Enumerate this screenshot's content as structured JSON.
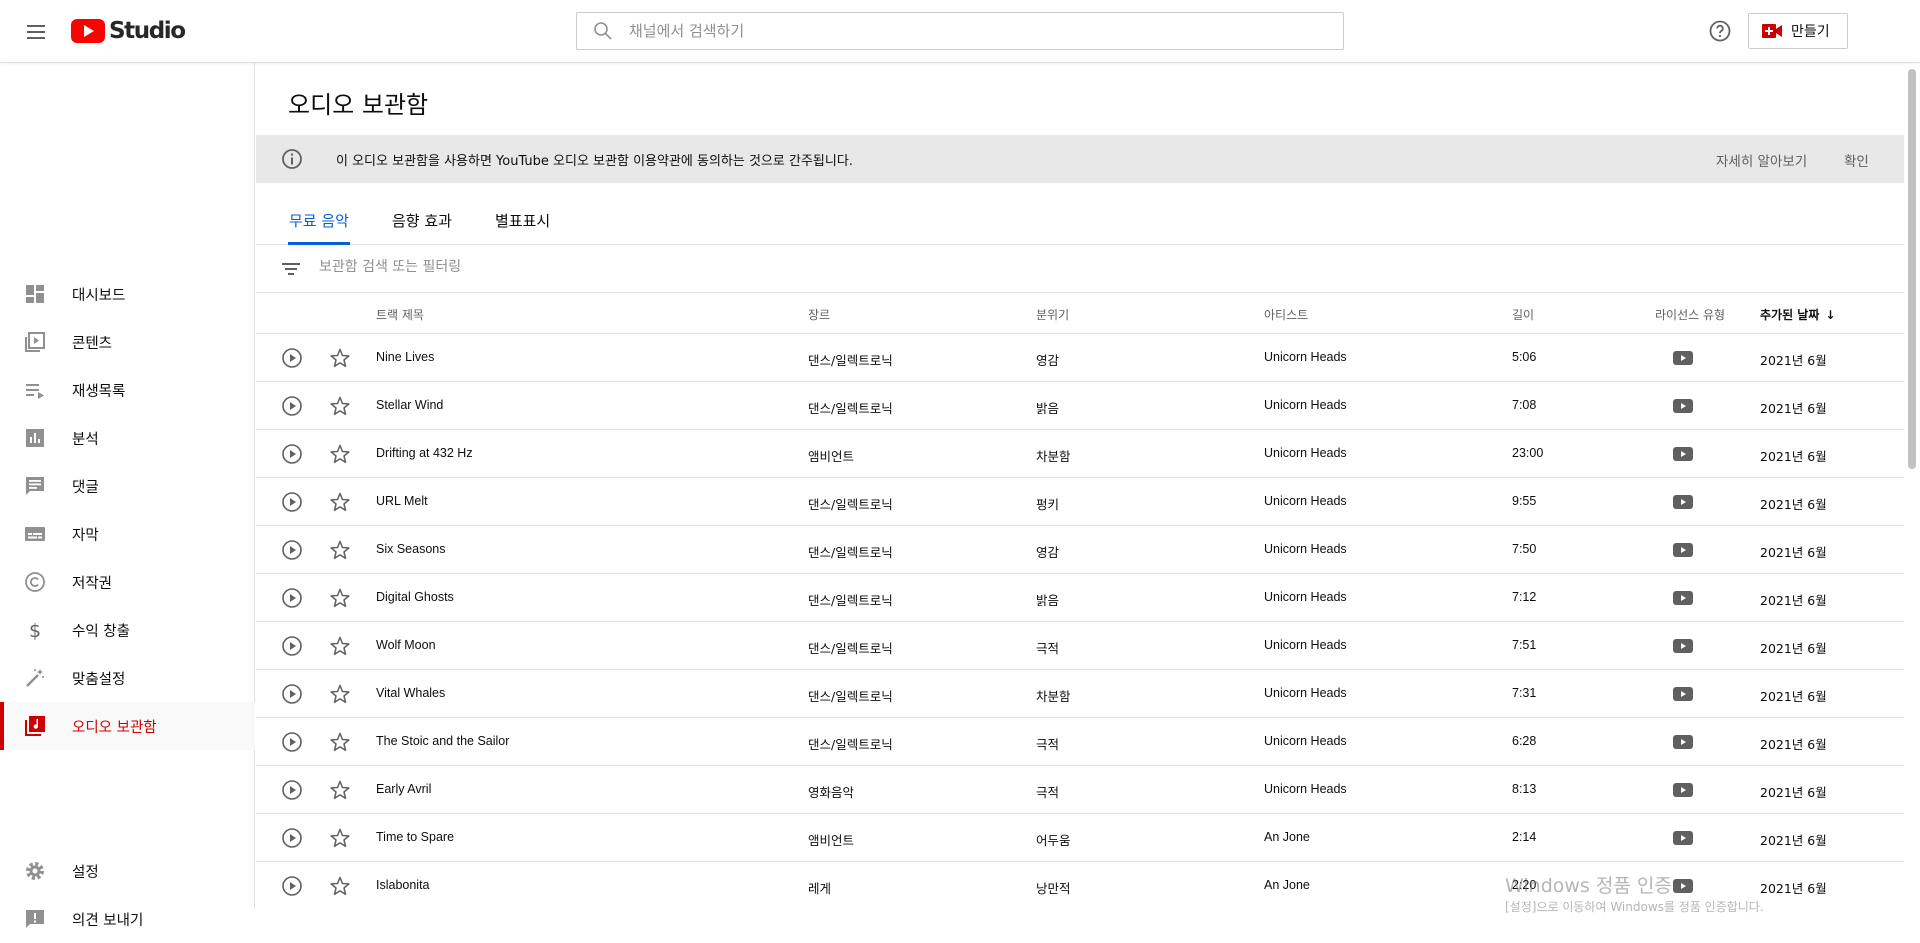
{
  "header": {
    "logo_text": "Studio",
    "search_placeholder": "채널에서 검색하기",
    "create_label": "만들기"
  },
  "sidebar": {
    "items": [
      {
        "label": "대시보드",
        "icon": "dashboard-icon"
      },
      {
        "label": "콘텐츠",
        "icon": "content-icon"
      },
      {
        "label": "재생목록",
        "icon": "playlist-icon"
      },
      {
        "label": "분석",
        "icon": "analytics-icon"
      },
      {
        "label": "댓글",
        "icon": "comments-icon"
      },
      {
        "label": "자막",
        "icon": "subtitles-icon"
      },
      {
        "label": "저작권",
        "icon": "copyright-icon"
      },
      {
        "label": "수익 창출",
        "icon": "dollar-icon"
      },
      {
        "label": "맞춤설정",
        "icon": "magic-wand-icon"
      },
      {
        "label": "오디오 보관함",
        "icon": "audio-library-icon",
        "active": true
      }
    ],
    "bottom": [
      {
        "label": "설정",
        "icon": "gear-icon"
      },
      {
        "label": "의견 보내기",
        "icon": "feedback-icon"
      }
    ]
  },
  "main": {
    "title": "오디오 보관함",
    "banner": {
      "message": "이 오디오 보관함을 사용하면 YouTube 오디오 보관함 이용약관에 동의하는 것으로 간주됩니다.",
      "learn_more": "자세히 알아보기",
      "confirm": "확인"
    },
    "tabs": [
      {
        "label": "무료 음악",
        "active": true
      },
      {
        "label": "음향 효과",
        "active": false
      },
      {
        "label": "별표표시",
        "active": false
      }
    ],
    "filter_placeholder": "보관함 검색 또는 필터링",
    "columns": {
      "title": "트랙 제목",
      "genre": "장르",
      "mood": "분위기",
      "artist": "아티스트",
      "duration": "길이",
      "license": "라이선스 유형",
      "date": "추가된 날짜"
    },
    "tracks": [
      {
        "title": "Nine Lives",
        "genre": "댄스/일렉트로닉",
        "mood": "영감",
        "artist": "Unicorn Heads",
        "duration": "5:06",
        "date": "2021년 6월"
      },
      {
        "title": "Stellar Wind",
        "genre": "댄스/일렉트로닉",
        "mood": "밝음",
        "artist": "Unicorn Heads",
        "duration": "7:08",
        "date": "2021년 6월"
      },
      {
        "title": "Drifting at 432 Hz",
        "genre": "앰비언트",
        "mood": "차분함",
        "artist": "Unicorn Heads",
        "duration": "23:00",
        "date": "2021년 6월"
      },
      {
        "title": "URL Melt",
        "genre": "댄스/일렉트로닉",
        "mood": "펑키",
        "artist": "Unicorn Heads",
        "duration": "9:55",
        "date": "2021년 6월"
      },
      {
        "title": "Six Seasons",
        "genre": "댄스/일렉트로닉",
        "mood": "영감",
        "artist": "Unicorn Heads",
        "duration": "7:50",
        "date": "2021년 6월"
      },
      {
        "title": "Digital Ghosts",
        "genre": "댄스/일렉트로닉",
        "mood": "밝음",
        "artist": "Unicorn Heads",
        "duration": "7:12",
        "date": "2021년 6월"
      },
      {
        "title": "Wolf Moon",
        "genre": "댄스/일렉트로닉",
        "mood": "극적",
        "artist": "Unicorn Heads",
        "duration": "7:51",
        "date": "2021년 6월"
      },
      {
        "title": "Vital Whales",
        "genre": "댄스/일렉트로닉",
        "mood": "차분함",
        "artist": "Unicorn Heads",
        "duration": "7:31",
        "date": "2021년 6월"
      },
      {
        "title": "The Stoic and the Sailor",
        "genre": "댄스/일렉트로닉",
        "mood": "극적",
        "artist": "Unicorn Heads",
        "duration": "6:28",
        "date": "2021년 6월"
      },
      {
        "title": "Early Avril",
        "genre": "영화음악",
        "mood": "극적",
        "artist": "Unicorn Heads",
        "duration": "8:13",
        "date": "2021년 6월"
      },
      {
        "title": "Time to Spare",
        "genre": "앰비언트",
        "mood": "어두움",
        "artist": "An Jone",
        "duration": "2:14",
        "date": "2021년 6월"
      },
      {
        "title": "Islabonita",
        "genre": "레게",
        "mood": "낭만적",
        "artist": "An Jone",
        "duration": "2:20",
        "date": "2021년 6월"
      }
    ]
  },
  "watermark": {
    "line1": "Windows 정품 인증",
    "line2": "[설정]으로 이동하여 Windows를 정품 인증합니다."
  },
  "colors": {
    "accent_red": "#cc0000",
    "tab_blue": "#065fd4",
    "banner_bg": "#e8e8e8"
  }
}
